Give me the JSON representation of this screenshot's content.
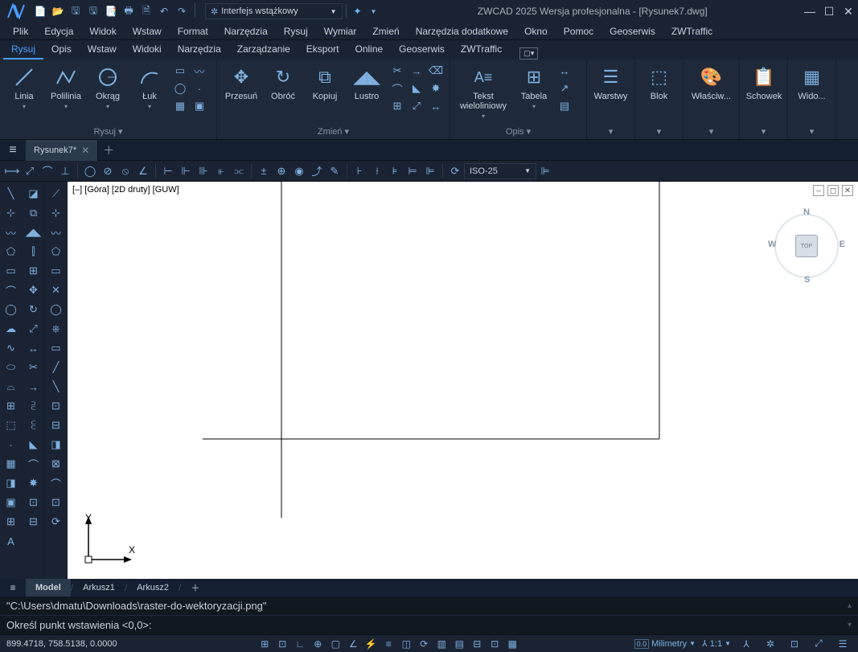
{
  "title": "ZWCAD 2025 Wersja profesjonalna - [Rysunek7.dwg]",
  "workspace": {
    "label": "Interfejs wstążkowy"
  },
  "menu": [
    "Plik",
    "Edycja",
    "Widok",
    "Wstaw",
    "Format",
    "Narzędzia",
    "Rysuj",
    "Wymiar",
    "Zmień",
    "Narzędzia dodatkowe",
    "Okno",
    "Pomoc",
    "Geoserwis",
    "ZWTraffic"
  ],
  "ribbon_tabs": [
    "Rysuj",
    "Opis",
    "Wstaw",
    "Widoki",
    "Narzędzia",
    "Zarządzanie",
    "Eksport",
    "Online",
    "Geoserwis",
    "ZWTraffic"
  ],
  "ribbon_active": "Rysuj",
  "panels": {
    "draw": {
      "title": "Rysuj ▾",
      "items": [
        "Linia",
        "Polilinia",
        "Okrąg",
        "Łuk"
      ]
    },
    "modify": {
      "title": "Zmień ▾",
      "items": [
        "Przesuń",
        "Obróć",
        "Kopiuj",
        "Lustro"
      ]
    },
    "annot": {
      "title": "Opis ▾",
      "items": [
        "Tekst wieloliniowy",
        "Tabela"
      ]
    },
    "layers": {
      "title": "",
      "label": "Warstwy"
    },
    "block": {
      "title": "",
      "label": "Blok"
    },
    "props": {
      "title": "",
      "label": "Właściw..."
    },
    "clip": {
      "title": "",
      "label": "Schowek"
    },
    "view": {
      "title": "",
      "label": "Wido..."
    }
  },
  "doc_tab": {
    "name": "Rysunek7*"
  },
  "dim_style": "ISO-25",
  "canvas_label": "[–] [Góra] [2D druty] [GUW]",
  "viewcube": {
    "n": "N",
    "s": "S",
    "e": "E",
    "w": "W",
    "face": "TOP"
  },
  "ucs": {
    "y": "Y",
    "x": "X"
  },
  "layout_tabs": [
    "Model",
    "Arkusz1",
    "Arkusz2"
  ],
  "layout_active": "Model",
  "cmd_history": "\"C:\\Users\\dmatu\\Downloads\\raster-do-wektoryzacji.png\"",
  "cmd_prompt": "Określ punkt wstawienia <0,0>: ",
  "status": {
    "coords": "899.4718, 758.5138, 0.0000",
    "units_badge": "0.0",
    "units": "Milimetry",
    "scale": "1:1"
  }
}
